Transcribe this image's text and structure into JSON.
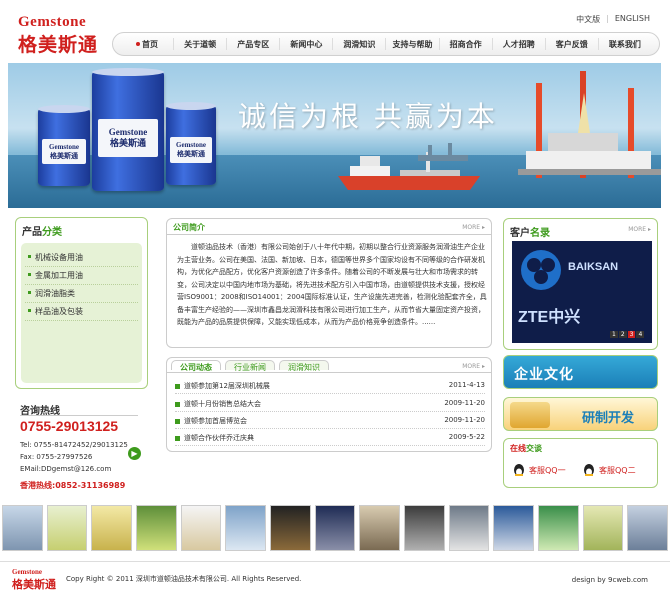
{
  "header": {
    "logo_en": "Gemstone",
    "logo_cn": "格美斯通",
    "lang_cn": "中文版",
    "lang_en": "ENGLISH",
    "nav": [
      "首页",
      "关于道顿",
      "产品专区",
      "新闻中心",
      "润滑知识",
      "支持与帮助",
      "招商合作",
      "人才招聘",
      "客户反馈",
      "联系我们"
    ]
  },
  "banner": {
    "slogan": "诚信为根  共赢为本",
    "drum_label_en": "Gemstone",
    "drum_label_cn": "格美斯通"
  },
  "products": {
    "title_a": "产品",
    "title_b": "分类",
    "items": [
      "机械设备用油",
      "金属加工用油",
      "润滑油脂类",
      "样品油及包装"
    ]
  },
  "hotline": {
    "title": "咨询热线",
    "phone": "0755-29013125",
    "tel": "Tel: 0755-81472452/29013125",
    "fax": "Fax: 0755-27997526",
    "email": "EMail:DDgemst@126.com",
    "hk": "香港热线:0852-31136989"
  },
  "intro": {
    "tab": "公司简介",
    "more": "MORE ▸",
    "text": "道顿油品技术（香港）有限公司始创于八十年代中期，初期以整合行业资源服务润滑油生产企业为主营业务。公司在美国、法国、新加坡、日本，德国等世界多个国家均设有不同等级的合作研发机构，为优化产品配方，优化客户资源创造了许多条件。随着公司的不断发展与壮大和市场需求的转变，公司决定以中国内地市场为基础，将先进技术配方引入中国市场，由道顿提供技术支援，授权经营ISO9001：2008和ISO14001：2004国际标准认证，生产设施先进完善，检测化验配套齐全，具备丰富生产经验的——深圳市鑫昌龙润滑科技有限公司进行加工生产，从而节省大量固定资产投资，既能为产品的品质提供保障，又能实现低成本，从而为产品价格竞争创造条件。......"
  },
  "news": {
    "tabs": [
      "公司动态",
      "行业新闻",
      "润滑知识"
    ],
    "more": "MORE ▸",
    "rows": [
      {
        "title": "道顿参加第12届深圳机械展",
        "date": "2011-4-13"
      },
      {
        "title": "道顿十月份销售总结大会",
        "date": "2009-11-20"
      },
      {
        "title": "道顿参加首届博览会",
        "date": "2009-11-20"
      },
      {
        "title": "道顿合作伙伴乔迁庆典",
        "date": "2009-5-22"
      }
    ]
  },
  "clients": {
    "title_a": "客户",
    "title_b": "名录",
    "more": "MORE ▸",
    "logo1": "BAIKSAN",
    "logo2": "ZTE中兴",
    "pager": [
      "1",
      "2",
      "3",
      "4"
    ]
  },
  "side_banners": {
    "culture": "企业文化",
    "rd": "研制开发"
  },
  "online": {
    "title_a": "在线",
    "title_b": "交谈",
    "qq1": "客服QQ一",
    "qq2": "客服QQ二"
  },
  "footer": {
    "logo_en": "Gemstone",
    "logo_cn": "格美斯通",
    "copyright": "Copy Right © 2011 深圳市道顿油品技术有限公司. All Rights Reserved.",
    "design": "design by 9cweb.com"
  },
  "colors": {
    "brand_red": "#d0201e",
    "accent_green": "#3e9b1d"
  }
}
